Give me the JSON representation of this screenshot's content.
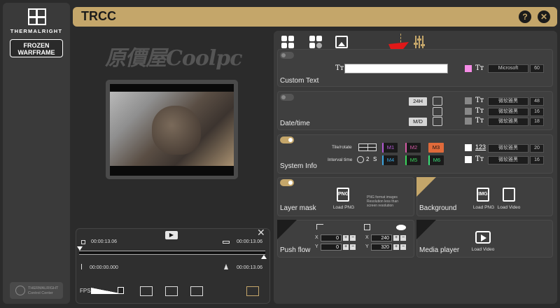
{
  "app": {
    "title": "TRCC",
    "help": "?",
    "close": "✕"
  },
  "sidebar": {
    "brand": "THERMALRIGHT",
    "device_label_1": "FROZEN",
    "device_label_2": "WARFRAME",
    "footer_1": "THERMALRIGHT",
    "footer_2": "Control Center"
  },
  "watermark": "原價屋Coolpc",
  "video": {
    "play": "▶",
    "close": "✕",
    "start_time": "00:00:13.06",
    "end_time": "00:00:13.06",
    "pos_time": "00:00:00.000",
    "total_time": "00:00:13.06",
    "fps_label": "FPS"
  },
  "panels": {
    "custom_text": {
      "label": "Custom Text",
      "font": "Microsoft",
      "size": "60",
      "color": "#f58ce6"
    },
    "datetime": {
      "label": "Date/time",
      "fmt_24h": "24H",
      "fmt_md": "M/D",
      "rows": [
        {
          "font": "微软雅黑",
          "size": "48"
        },
        {
          "font": "微软雅黑",
          "size": "16"
        },
        {
          "font": "微软雅黑",
          "size": "18"
        }
      ]
    },
    "system_info": {
      "label": "System Info",
      "tile_label": "Tile/rotate",
      "interval_label": "Interval time",
      "interval_value": "2",
      "interval_unit": "S",
      "m_buttons": [
        "M1",
        "M2",
        "M3",
        "M4",
        "M5",
        "M6"
      ],
      "rows": [
        {
          "icon": "123",
          "font": "微软雅黑",
          "size": "20"
        },
        {
          "font": "微软雅黑",
          "size": "16"
        }
      ]
    },
    "layer_mask": {
      "label": "Layer mask",
      "icon": "PNG",
      "load": "Load PNG",
      "note": "PNG format images Resolution less than screen resolution"
    },
    "background": {
      "label": "Background",
      "icon_img": "IMG",
      "load_png": "Load PNG",
      "load_video": "Load Video"
    },
    "push_flow": {
      "label": "Push flow",
      "x1": "0",
      "y1": "0",
      "x2": "240",
      "y2": "320",
      "x_label": "X",
      "y_label": "Y"
    },
    "media_player": {
      "label": "Media player",
      "load_video": "Load Video"
    }
  },
  "colors": {
    "accent": "#c4a66a",
    "m1": "#b65ad6",
    "m2": "#d65aa6",
    "m3": "#e06a3a",
    "m4": "#3aa6e0",
    "m5": "#3ad65a",
    "m6": "#3ae07a"
  }
}
